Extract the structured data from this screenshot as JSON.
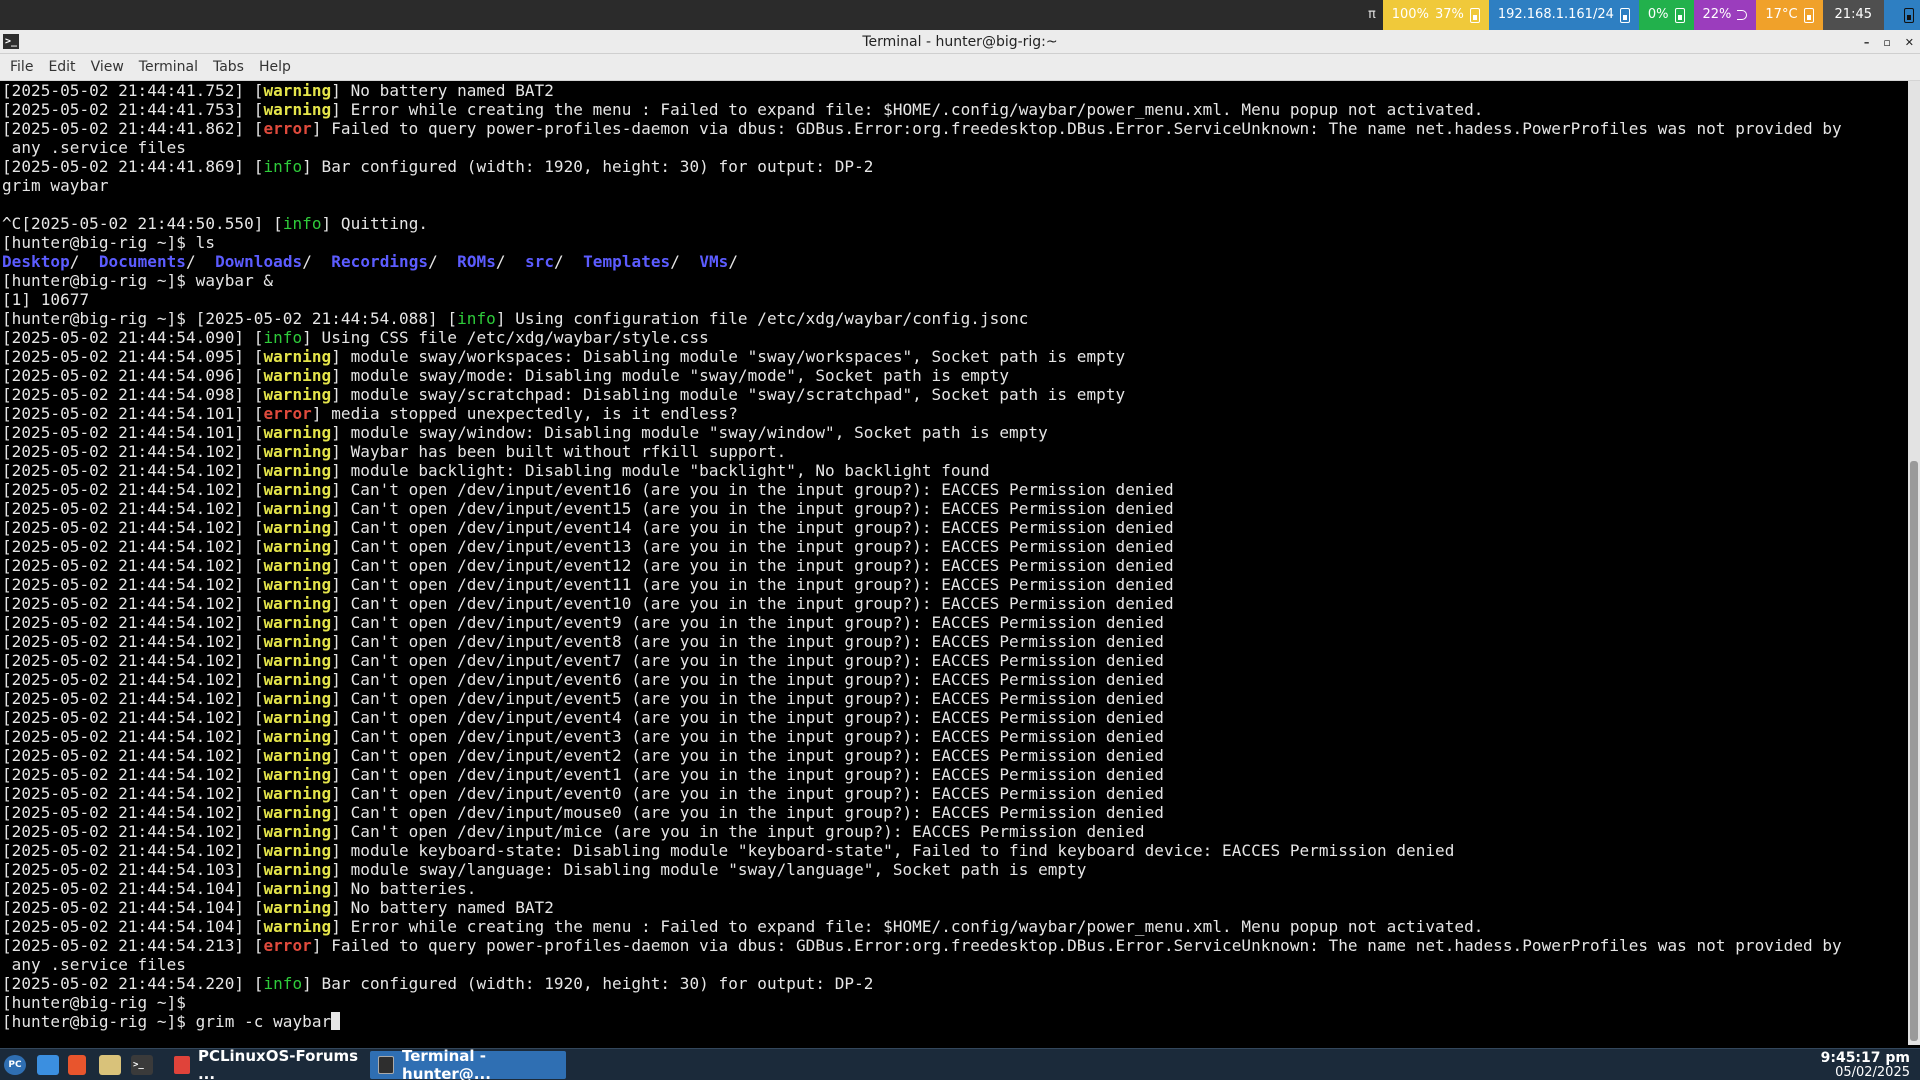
{
  "waybar": {
    "glyph": "π",
    "cpu": "100%",
    "mem": "37%",
    "net": "192.168.1.161/24",
    "vol": "0%",
    "bright": "22%",
    "temp": "17°C",
    "clock": "21:45",
    "colors": {
      "cpu": "#f0c93a",
      "net": "#2e7fc2",
      "vol": "#22b14c",
      "bright": "#9b3dbd",
      "temp": "#f0a12a",
      "clock": "#4f4f4f",
      "end": "#2e7fc2"
    }
  },
  "window": {
    "title": "Terminal - hunter@big-rig:~",
    "controls": [
      "–",
      "▫",
      "✕"
    ]
  },
  "menu": [
    "File",
    "Edit",
    "View",
    "Terminal",
    "Tabs",
    "Help"
  ],
  "terminal": {
    "lines": [
      [
        [
          "[2025-05-02 21:44:41.752] [",
          ""
        ],
        [
          "warning",
          "warning"
        ],
        [
          "] No battery named BAT2",
          ""
        ]
      ],
      [
        [
          "[2025-05-02 21:44:41.753] [",
          ""
        ],
        [
          "warning",
          "warning"
        ],
        [
          "] Error while creating the menu : Failed to expand file: $HOME/.config/waybar/power_menu.xml. Menu popup not activated.",
          ""
        ]
      ],
      [
        [
          "[2025-05-02 21:44:41.862] [",
          ""
        ],
        [
          "error",
          "error"
        ],
        [
          "] Failed to query power-profiles-daemon via dbus: GDBus.Error:org.freedesktop.DBus.Error.ServiceUnknown: The name net.hadess.PowerProfiles was not provided by",
          ""
        ]
      ],
      [
        [
          " any .service files",
          ""
        ]
      ],
      [
        [
          "[2025-05-02 21:44:41.869] [",
          ""
        ],
        [
          "info",
          "info"
        ],
        [
          "] Bar configured (width: 1920, height: 30) for output: DP-2",
          ""
        ]
      ],
      [
        [
          "grim waybar",
          ""
        ]
      ],
      [
        [
          "",
          ""
        ]
      ],
      [
        [
          "^C[2025-05-02 21:44:50.550] [",
          ""
        ],
        [
          "info",
          "info"
        ],
        [
          "] Quitting.",
          ""
        ]
      ],
      [
        [
          "[hunter@big-rig ~]$ ls",
          ""
        ]
      ],
      [
        [
          "Desktop",
          "dir"
        ],
        [
          "/  ",
          ""
        ],
        [
          "Documents",
          "dir"
        ],
        [
          "/  ",
          ""
        ],
        [
          "Downloads",
          "dir"
        ],
        [
          "/  ",
          ""
        ],
        [
          "Recordings",
          "dir"
        ],
        [
          "/  ",
          ""
        ],
        [
          "ROMs",
          "dir"
        ],
        [
          "/  ",
          ""
        ],
        [
          "src",
          "dir"
        ],
        [
          "/  ",
          ""
        ],
        [
          "Templates",
          "dir"
        ],
        [
          "/  ",
          ""
        ],
        [
          "VMs",
          "dir"
        ],
        [
          "/",
          ""
        ]
      ],
      [
        [
          "[hunter@big-rig ~]$ waybar &",
          ""
        ]
      ],
      [
        [
          "[1] 10677",
          ""
        ]
      ],
      [
        [
          "[hunter@big-rig ~]$ [2025-05-02 21:44:54.088] [",
          ""
        ],
        [
          "info",
          "info"
        ],
        [
          "] Using configuration file /etc/xdg/waybar/config.jsonc",
          ""
        ]
      ],
      [
        [
          "[2025-05-02 21:44:54.090] [",
          ""
        ],
        [
          "info",
          "info"
        ],
        [
          "] Using CSS file /etc/xdg/waybar/style.css",
          ""
        ]
      ],
      [
        [
          "[2025-05-02 21:44:54.095] [",
          ""
        ],
        [
          "warning",
          "warning"
        ],
        [
          "] module sway/workspaces: Disabling module \"sway/workspaces\", Socket path is empty",
          ""
        ]
      ],
      [
        [
          "[2025-05-02 21:44:54.096] [",
          ""
        ],
        [
          "warning",
          "warning"
        ],
        [
          "] module sway/mode: Disabling module \"sway/mode\", Socket path is empty",
          ""
        ]
      ],
      [
        [
          "[2025-05-02 21:44:54.098] [",
          ""
        ],
        [
          "warning",
          "warning"
        ],
        [
          "] module sway/scratchpad: Disabling module \"sway/scratchpad\", Socket path is empty",
          ""
        ]
      ],
      [
        [
          "[2025-05-02 21:44:54.101] [",
          ""
        ],
        [
          "error",
          "error"
        ],
        [
          "] media stopped unexpectedly, is it endless?",
          ""
        ]
      ],
      [
        [
          "[2025-05-02 21:44:54.101] [",
          ""
        ],
        [
          "warning",
          "warning"
        ],
        [
          "] module sway/window: Disabling module \"sway/window\", Socket path is empty",
          ""
        ]
      ],
      [
        [
          "[2025-05-02 21:44:54.102] [",
          ""
        ],
        [
          "warning",
          "warning"
        ],
        [
          "] Waybar has been built without rfkill support.",
          ""
        ]
      ],
      [
        [
          "[2025-05-02 21:44:54.102] [",
          ""
        ],
        [
          "warning",
          "warning"
        ],
        [
          "] module backlight: Disabling module \"backlight\", No backlight found",
          ""
        ]
      ],
      [
        [
          "[2025-05-02 21:44:54.102] [",
          ""
        ],
        [
          "warning",
          "warning"
        ],
        [
          "] Can't open /dev/input/event16 (are you in the input group?): EACCES Permission denied",
          ""
        ]
      ],
      [
        [
          "[2025-05-02 21:44:54.102] [",
          ""
        ],
        [
          "warning",
          "warning"
        ],
        [
          "] Can't open /dev/input/event15 (are you in the input group?): EACCES Permission denied",
          ""
        ]
      ],
      [
        [
          "[2025-05-02 21:44:54.102] [",
          ""
        ],
        [
          "warning",
          "warning"
        ],
        [
          "] Can't open /dev/input/event14 (are you in the input group?): EACCES Permission denied",
          ""
        ]
      ],
      [
        [
          "[2025-05-02 21:44:54.102] [",
          ""
        ],
        [
          "warning",
          "warning"
        ],
        [
          "] Can't open /dev/input/event13 (are you in the input group?): EACCES Permission denied",
          ""
        ]
      ],
      [
        [
          "[2025-05-02 21:44:54.102] [",
          ""
        ],
        [
          "warning",
          "warning"
        ],
        [
          "] Can't open /dev/input/event12 (are you in the input group?): EACCES Permission denied",
          ""
        ]
      ],
      [
        [
          "[2025-05-02 21:44:54.102] [",
          ""
        ],
        [
          "warning",
          "warning"
        ],
        [
          "] Can't open /dev/input/event11 (are you in the input group?): EACCES Permission denied",
          ""
        ]
      ],
      [
        [
          "[2025-05-02 21:44:54.102] [",
          ""
        ],
        [
          "warning",
          "warning"
        ],
        [
          "] Can't open /dev/input/event10 (are you in the input group?): EACCES Permission denied",
          ""
        ]
      ],
      [
        [
          "[2025-05-02 21:44:54.102] [",
          ""
        ],
        [
          "warning",
          "warning"
        ],
        [
          "] Can't open /dev/input/event9 (are you in the input group?): EACCES Permission denied",
          ""
        ]
      ],
      [
        [
          "[2025-05-02 21:44:54.102] [",
          ""
        ],
        [
          "warning",
          "warning"
        ],
        [
          "] Can't open /dev/input/event8 (are you in the input group?): EACCES Permission denied",
          ""
        ]
      ],
      [
        [
          "[2025-05-02 21:44:54.102] [",
          ""
        ],
        [
          "warning",
          "warning"
        ],
        [
          "] Can't open /dev/input/event7 (are you in the input group?): EACCES Permission denied",
          ""
        ]
      ],
      [
        [
          "[2025-05-02 21:44:54.102] [",
          ""
        ],
        [
          "warning",
          "warning"
        ],
        [
          "] Can't open /dev/input/event6 (are you in the input group?): EACCES Permission denied",
          ""
        ]
      ],
      [
        [
          "[2025-05-02 21:44:54.102] [",
          ""
        ],
        [
          "warning",
          "warning"
        ],
        [
          "] Can't open /dev/input/event5 (are you in the input group?): EACCES Permission denied",
          ""
        ]
      ],
      [
        [
          "[2025-05-02 21:44:54.102] [",
          ""
        ],
        [
          "warning",
          "warning"
        ],
        [
          "] Can't open /dev/input/event4 (are you in the input group?): EACCES Permission denied",
          ""
        ]
      ],
      [
        [
          "[2025-05-02 21:44:54.102] [",
          ""
        ],
        [
          "warning",
          "warning"
        ],
        [
          "] Can't open /dev/input/event3 (are you in the input group?): EACCES Permission denied",
          ""
        ]
      ],
      [
        [
          "[2025-05-02 21:44:54.102] [",
          ""
        ],
        [
          "warning",
          "warning"
        ],
        [
          "] Can't open /dev/input/event2 (are you in the input group?): EACCES Permission denied",
          ""
        ]
      ],
      [
        [
          "[2025-05-02 21:44:54.102] [",
          ""
        ],
        [
          "warning",
          "warning"
        ],
        [
          "] Can't open /dev/input/event1 (are you in the input group?): EACCES Permission denied",
          ""
        ]
      ],
      [
        [
          "[2025-05-02 21:44:54.102] [",
          ""
        ],
        [
          "warning",
          "warning"
        ],
        [
          "] Can't open /dev/input/event0 (are you in the input group?): EACCES Permission denied",
          ""
        ]
      ],
      [
        [
          "[2025-05-02 21:44:54.102] [",
          ""
        ],
        [
          "warning",
          "warning"
        ],
        [
          "] Can't open /dev/input/mouse0 (are you in the input group?): EACCES Permission denied",
          ""
        ]
      ],
      [
        [
          "[2025-05-02 21:44:54.102] [",
          ""
        ],
        [
          "warning",
          "warning"
        ],
        [
          "] Can't open /dev/input/mice (are you in the input group?): EACCES Permission denied",
          ""
        ]
      ],
      [
        [
          "[2025-05-02 21:44:54.102] [",
          ""
        ],
        [
          "warning",
          "warning"
        ],
        [
          "] module keyboard-state: Disabling module \"keyboard-state\", Failed to find keyboard device: EACCES Permission denied",
          ""
        ]
      ],
      [
        [
          "[2025-05-02 21:44:54.103] [",
          ""
        ],
        [
          "warning",
          "warning"
        ],
        [
          "] module sway/language: Disabling module \"sway/language\", Socket path is empty",
          ""
        ]
      ],
      [
        [
          "[2025-05-02 21:44:54.104] [",
          ""
        ],
        [
          "warning",
          "warning"
        ],
        [
          "] No batteries.",
          ""
        ]
      ],
      [
        [
          "[2025-05-02 21:44:54.104] [",
          ""
        ],
        [
          "warning",
          "warning"
        ],
        [
          "] No battery named BAT2",
          ""
        ]
      ],
      [
        [
          "[2025-05-02 21:44:54.104] [",
          ""
        ],
        [
          "warning",
          "warning"
        ],
        [
          "] Error while creating the menu : Failed to expand file: $HOME/.config/waybar/power_menu.xml. Menu popup not activated.",
          ""
        ]
      ],
      [
        [
          "[2025-05-02 21:44:54.213] [",
          ""
        ],
        [
          "error",
          "error"
        ],
        [
          "] Failed to query power-profiles-daemon via dbus: GDBus.Error:org.freedesktop.DBus.Error.ServiceUnknown: The name net.hadess.PowerProfiles was not provided by",
          ""
        ]
      ],
      [
        [
          " any .service files",
          ""
        ]
      ],
      [
        [
          "[2025-05-02 21:44:54.220] [",
          ""
        ],
        [
          "info",
          "info"
        ],
        [
          "] Bar configured (width: 1920, height: 30) for output: DP-2",
          ""
        ]
      ],
      [
        [
          "[hunter@big-rig ~]$",
          ""
        ]
      ],
      [
        [
          "[hunter@big-rig ~]$ grim -c waybar",
          ""
        ]
      ]
    ]
  },
  "taskbar": {
    "tasks": [
      {
        "label": "PCLinuxOS-Forums ...",
        "icon_color": "#e0433a"
      },
      {
        "label": "Terminal - hunter@...",
        "icon_color": "#2e2e2e"
      }
    ],
    "launchers": [
      {
        "name": "pclinuxos-menu-icon",
        "color": "#2f6fb3"
      },
      {
        "name": "show-desktop-icon",
        "color": "#3b8fe0"
      },
      {
        "name": "brave-browser-icon",
        "color": "#e8552d"
      },
      {
        "name": "file-manager-icon",
        "color": "#d9c27a"
      },
      {
        "name": "terminal-launcher-icon",
        "color": "#3a3a3a"
      }
    ],
    "clock_time": "9:45:17 pm",
    "clock_date": "05/02/2025"
  }
}
